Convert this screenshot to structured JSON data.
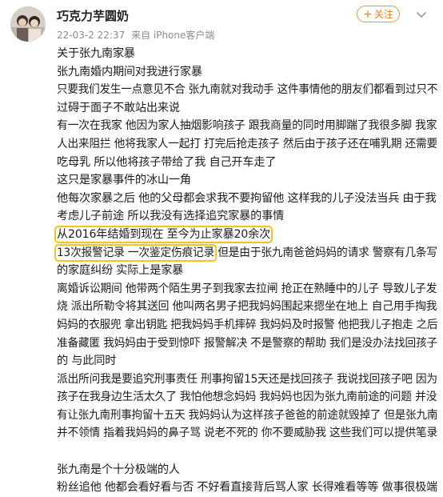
{
  "post": {
    "username": "巧克力芋圆奶",
    "date": "22-03-2 22:37",
    "source": "来自 iPhone客户端",
    "follow_label": "关注",
    "follow_plus": "+",
    "more_icon": "chevron-down-icon",
    "highlight_color": "#f6c21b",
    "accent_color": "#f08216"
  },
  "content": {
    "lines": [
      "关于张九南家暴",
      "张九南婚内期间对我进行家暴",
      "只要我们发生一点意见不合 张九南就对我动手 这件事情他的朋友们都看到过只不",
      "过碍于面子不敢站出来说",
      "有一次在我家 他因为家人抽烟影响孩子 跟我商量的同时用脚踹了我很多脚 我家",
      "人出来阻拦 他将我家人一起打 打完后抢走孩子 然后由于孩子还在哺乳期 还需要",
      "吃母乳 所以他将孩子带给了我 自己开车走了",
      "这只是家暴事件的冰山一角",
      "他每次家暴之后 他的父母都会求我不要拘留他 这样我的儿子没法当兵 由于我",
      "考虑儿子前途 所以我没有选择追究家暴的事情",
      "从2016年结婚到现在 至今为止家暴20余次",
      "13次报警记录 一次鉴定伤痕记录 但是由于张九南爸爸妈妈的请求 警察有几条写",
      "的家庭纠纷 实际上是家暴",
      "离婚诉讼期间 他带两个陌生男子到我家去拉闸 抢正在熟睡中的儿子 导致儿子发",
      "烧 派出所勒令将其送回 他叫两名男子把我妈妈围起来摁坐在地上 自己用手掏我",
      "妈妈的衣服兜 拿出钥匙 把我妈妈手机摔碎 我妈妈及时报警 他把我儿子抱走 之后",
      "准备藏匿 我妈妈由于受到惊吓 报警解决 不是警察的帮助 我们是没办法找回孩子",
      "的 与此同时",
      "派出所问我是要追究刑事责任 刑事拘留15天还是找回孩子 我说找回孩子吧 因为",
      "孩子在我身边生活太久了 我怕他想念妈妈 我妈妈也因为张九南前途的问题 并没",
      "有让张九南刑事拘留十五天 我妈妈认为这样孩子爸爸的前途就毁掉了 但是张九南",
      "并不领情 指着我妈妈的鼻子骂 说老不死的 你不要威胁我 这些我们可以提供笔录",
      "",
      "张九南是个十分极端的人",
      "粉丝追他 他都会看好看与否 不好看直接背后骂人家 长得难看等等 做事很极端"
    ],
    "highlight_1": "从2016年结婚到现在 至今为止家暴20余次",
    "highlight_2_a": "13次报警记录 一次鉴定伤痕记录",
    "highlight_2_b": " 但是由于张九南爸爸妈妈的请求 警察有几条写"
  }
}
